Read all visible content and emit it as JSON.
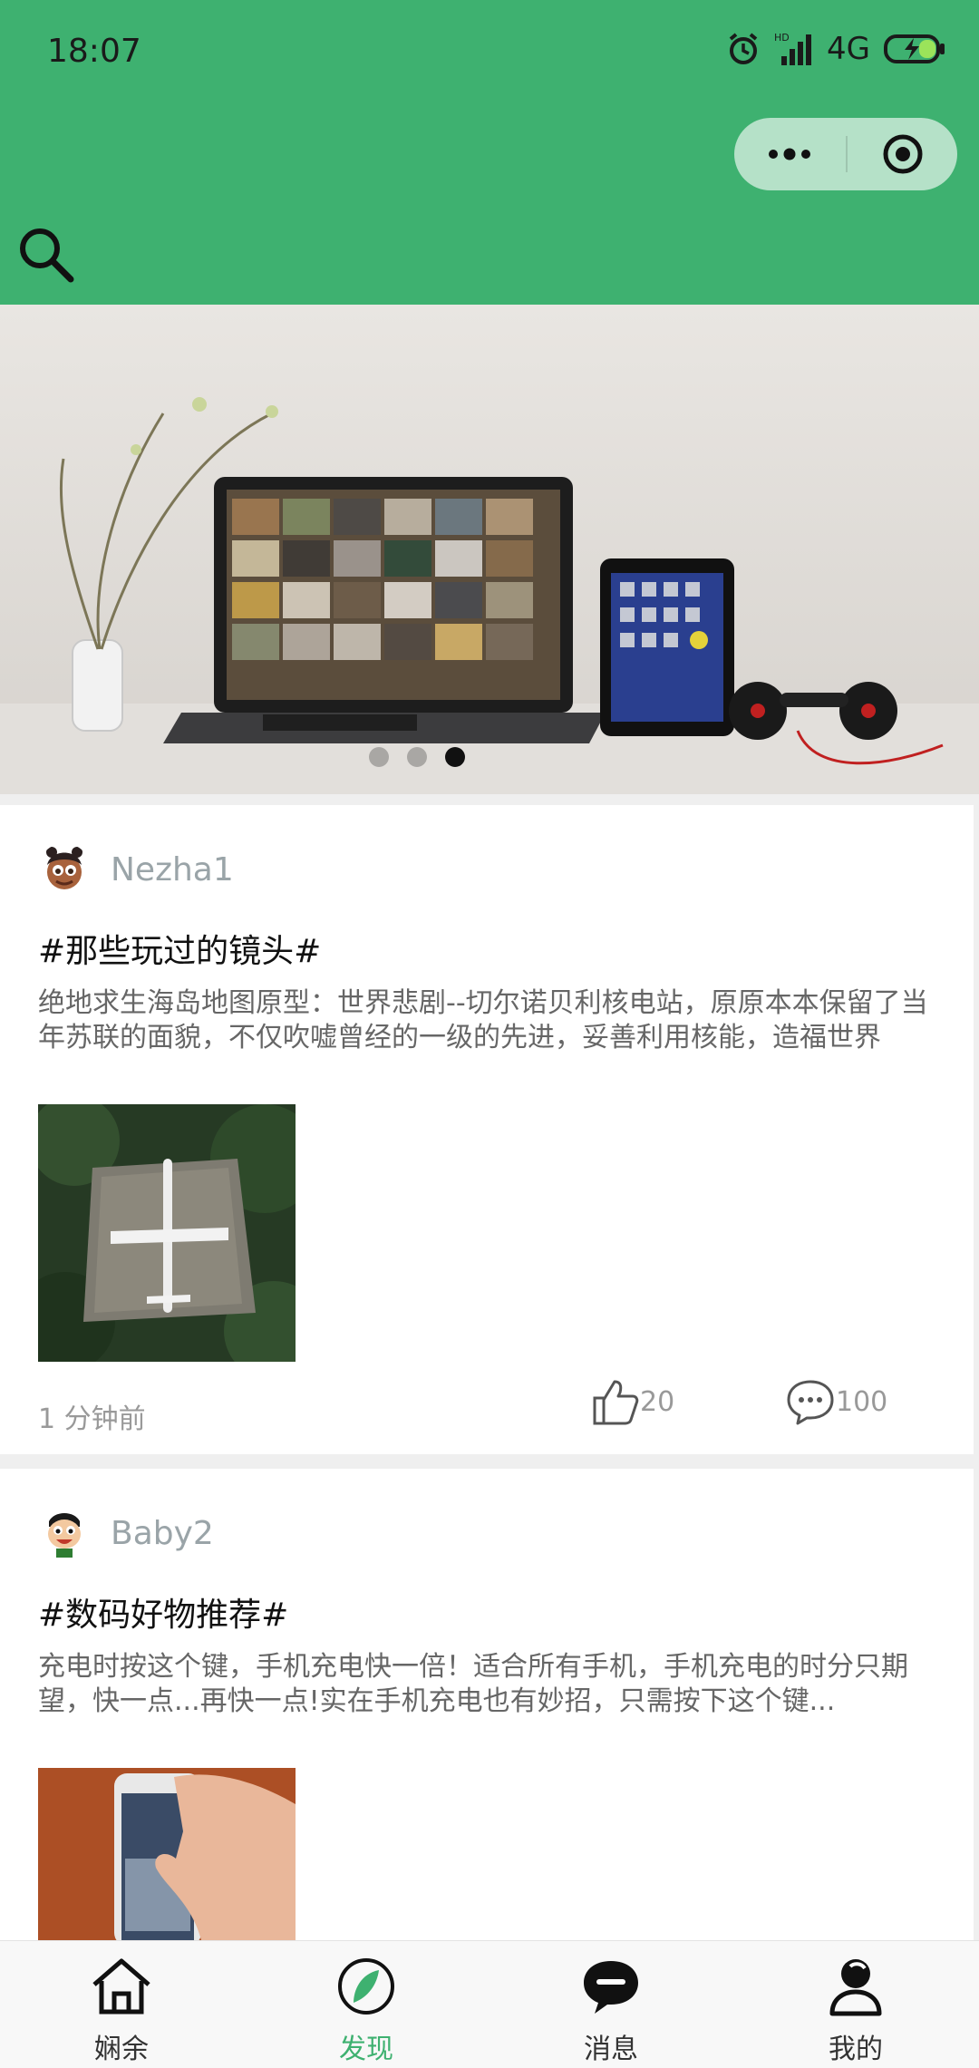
{
  "status_bar": {
    "time": "18:07",
    "network": "4G",
    "battery_icon": "battery-charging-icon",
    "alarm_icon": "alarm-icon",
    "signal_icon": "signal-icon"
  },
  "header": {
    "search_icon": "search-icon",
    "menu_icon": "more-dots-icon",
    "close_icon": "target-icon",
    "bg_color": "#3eb170"
  },
  "banner": {
    "dots_count": 3,
    "active_index": 2
  },
  "posts": [
    {
      "author": "Nezha1",
      "title": "#那些玩过的镜头#",
      "content": "绝地求生海岛地图原型：世界悲剧--切尔诺贝利核电站，原原本本保留了当年苏联的面貌，不仅吹嘘曾经的一级的先进，妥善利用核能，造福世界",
      "time": "1 分钟前",
      "likes": "20",
      "comments": "100"
    },
    {
      "author": "Baby2",
      "title": "#数码好物推荐#",
      "content": "充电时按这个键，手机充电快一倍！适合所有手机，手机充电的时分只期望，快一点...再快一点!实在手机充电也有妙招，只需按下这个键..."
    }
  ],
  "tabs": [
    {
      "label": "娴余",
      "icon": "home-icon"
    },
    {
      "label": "发现",
      "icon": "compass-icon"
    },
    {
      "label": "消息",
      "icon": "message-icon"
    },
    {
      "label": "我的",
      "icon": "user-icon"
    }
  ],
  "colors": {
    "accent": "#3eb170",
    "muted": "#999999"
  }
}
